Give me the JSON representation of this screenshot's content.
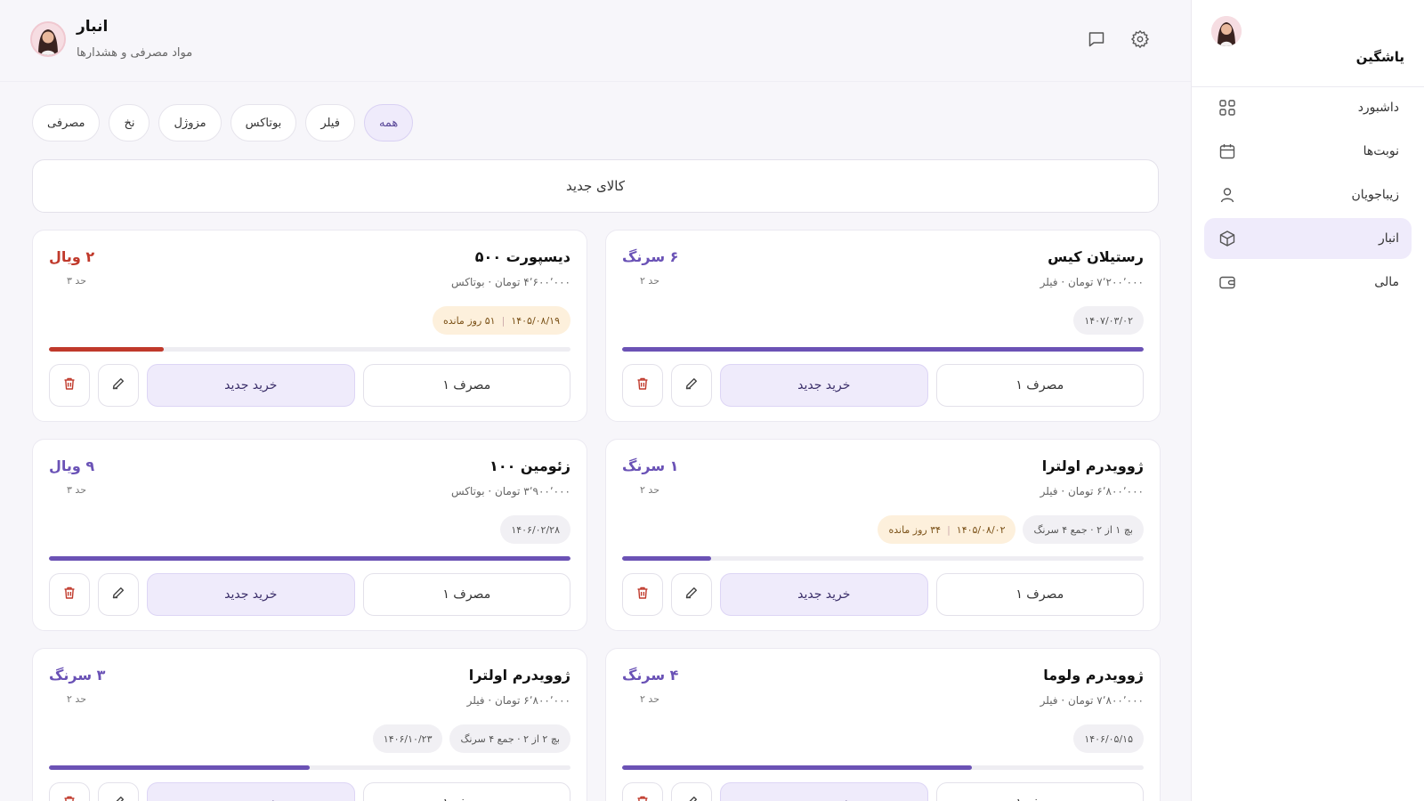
{
  "brand": {
    "name": "یاشگین"
  },
  "sidebar": {
    "items": [
      {
        "label": "داشبورد",
        "icon": "dashboard-icon"
      },
      {
        "label": "نوبت‌ها",
        "icon": "calendar-icon"
      },
      {
        "label": "زیباجویان",
        "icon": "user-icon"
      },
      {
        "label": "انبار",
        "icon": "box-icon",
        "active": true
      },
      {
        "label": "مالی",
        "icon": "wallet-icon"
      }
    ]
  },
  "header": {
    "title": "انبار",
    "subtitle": "مواد مصرفی و هشدارها"
  },
  "filters": [
    "همه",
    "فیلر",
    "بوتاکس",
    "مزوژل",
    "نخ",
    "مصرفی"
  ],
  "new_item_label": "کالای جدید",
  "actions": {
    "buy": "خرید جدید",
    "use": "مصرف ۱"
  },
  "colors": {
    "accent": "#6b52b5",
    "danger": "#c0392b",
    "active_bg": "#efebfb",
    "warn_bg": "#fdf0dc"
  },
  "products": [
    {
      "name": "رستیلان کیس",
      "meta": "۷٬۲۰۰٬۰۰۰ تومان · فیلر",
      "qty": "۶ سرنگ",
      "limit": "حد ۲",
      "low": false,
      "stock_level": 1.0,
      "badges": [
        {
          "text": "۱۴۰۷/۰۳/۰۲"
        }
      ]
    },
    {
      "name": "دیسپورت ۵۰۰",
      "meta": "۴٬۶۰۰٬۰۰۰ تومان · بوتاکس",
      "qty": "۲ ویال",
      "limit": "حد ۳",
      "low": true,
      "stock_level": 0.22,
      "badges": [
        {
          "date": "۱۴۰۵/۰۸/۱۹",
          "days": "۵۱ روز مانده",
          "warn": true
        }
      ]
    },
    {
      "name": "ژوویدرم اولترا",
      "meta": "۶٬۸۰۰٬۰۰۰ تومان · فیلر",
      "qty": "۱ سرنگ",
      "limit": "حد ۲",
      "low": false,
      "stock_level": 0.17,
      "badges": [
        {
          "text": "بچ ۱ از ۲ · جمع ۴ سرنگ"
        },
        {
          "date": "۱۴۰۵/۰۸/۰۲",
          "days": "۳۴ روز مانده",
          "warn": true
        }
      ]
    },
    {
      "name": "زئومین ۱۰۰",
      "meta": "۳٬۹۰۰٬۰۰۰ تومان · بوتاکس",
      "qty": "۹ ویال",
      "limit": "حد ۳",
      "low": false,
      "stock_level": 1.0,
      "badges": [
        {
          "text": "۱۴۰۶/۰۲/۲۸"
        }
      ]
    },
    {
      "name": "ژوویدرم ولوما",
      "meta": "۷٬۸۰۰٬۰۰۰ تومان · فیلر",
      "qty": "۴ سرنگ",
      "limit": "حد ۲",
      "low": false,
      "stock_level": 0.67,
      "badges": [
        {
          "text": "۱۴۰۶/۰۵/۱۵"
        }
      ]
    },
    {
      "name": "ژوویدرم اولترا",
      "meta": "۶٬۸۰۰٬۰۰۰ تومان · فیلر",
      "qty": "۳ سرنگ",
      "limit": "حد ۲",
      "low": false,
      "stock_level": 0.5,
      "badges": [
        {
          "text": "بچ ۲ از ۲ · جمع ۴ سرنگ"
        },
        {
          "text": "۱۴۰۶/۱۰/۲۳"
        }
      ]
    }
  ]
}
